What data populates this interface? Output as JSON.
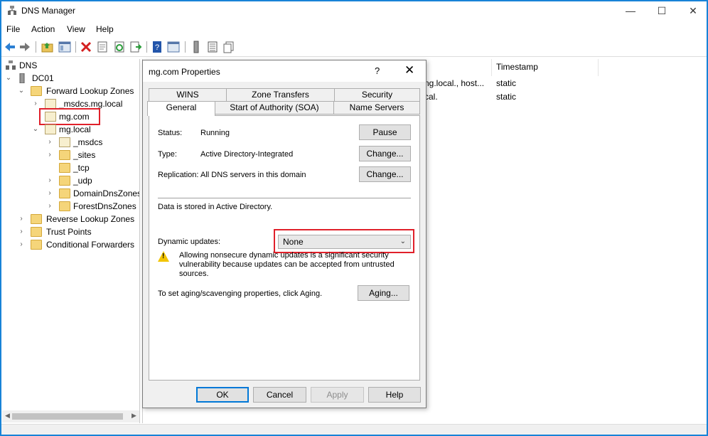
{
  "window": {
    "title": "DNS Manager",
    "minimize": "—",
    "maximize": "☐",
    "close": "✕"
  },
  "menu": [
    "File",
    "Action",
    "View",
    "Help"
  ],
  "tree": {
    "root": "DNS",
    "server": "DC01",
    "forward": "Forward Lookup Zones",
    "msdcs_zone": "_msdcs.mg.local",
    "mgcom": "mg.com",
    "mglocal": "mg.local",
    "sub_msdcs": "_msdcs",
    "sub_sites": "_sites",
    "sub_tcp": "_tcp",
    "sub_udp": "_udp",
    "domaindns": "DomainDnsZones",
    "forestdns": "ForestDnsZones",
    "reverse": "Reverse Lookup Zones",
    "trust": "Trust Points",
    "conditional": "Conditional Forwarders"
  },
  "list": {
    "timestamp_header": "Timestamp",
    "rows": [
      {
        "data": "ng.local., host...",
        "timestamp": "static"
      },
      {
        "data": "cal.",
        "timestamp": "static"
      }
    ]
  },
  "dialog": {
    "title": "mg.com Properties",
    "help": "?",
    "close": "✕",
    "tabs_row1": [
      "WINS",
      "Zone Transfers",
      "Security"
    ],
    "tabs_row2": [
      "General",
      "Start of Authority (SOA)",
      "Name Servers"
    ],
    "status_label": "Status:",
    "status_value": "Running",
    "pause_button": "Pause",
    "type_label": "Type:",
    "type_value": "Active Directory-Integrated",
    "change_button": "Change...",
    "replication_label": "Replication:",
    "replication_value": "All DNS servers in this domain",
    "change_button2": "Change...",
    "stored_text": "Data is stored in Active Directory.",
    "dynamic_label": "Dynamic updates:",
    "dynamic_value": "None",
    "warning_line1": "Allowing nonsecure dynamic updates is a significant security",
    "warning_line2": "vulnerability because updates can be accepted from untrusted",
    "warning_line3": "sources.",
    "aging_text": "To set aging/scavenging properties, click Aging.",
    "aging_button": "Aging...",
    "ok": "OK",
    "cancel": "Cancel",
    "apply": "Apply",
    "help_button": "Help"
  },
  "colors": {
    "window_border": "#1883d7",
    "highlight": "#e0202a",
    "default_button_border": "#0078d7"
  }
}
